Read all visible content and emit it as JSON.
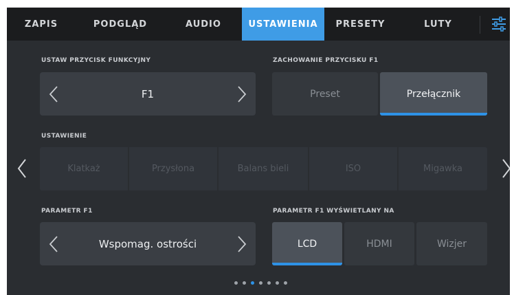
{
  "tabs": [
    {
      "label": "ZAPIS"
    },
    {
      "label": "PODGLĄD"
    },
    {
      "label": "AUDIO"
    },
    {
      "label": "USTAWIENIA",
      "active": true
    },
    {
      "label": "PRESETY"
    },
    {
      "label": "LUTY"
    }
  ],
  "menu_icon": "sliders-icon",
  "function_button": {
    "label": "USTAW PRZYCISK FUNKCYJNY",
    "value": "F1"
  },
  "button_behavior": {
    "label": "ZACHOWANIE PRZYCISKU F1",
    "options": [
      "Preset",
      "Przełącznik"
    ],
    "selected": "Przełącznik"
  },
  "setting": {
    "label": "USTAWIENIE",
    "options": [
      "Klatkaż",
      "Przysłona",
      "Balans bieli",
      "ISO",
      "Migawka"
    ]
  },
  "parameter": {
    "label": "PARAMETR F1",
    "value": "Wspomag. ostrości"
  },
  "displayed_on": {
    "label": "PARAMETR F1 WYŚWIETLANY NA",
    "options": [
      "LCD",
      "HDMI",
      "Wizjer"
    ],
    "selected": "LCD"
  },
  "pagination": {
    "total": 7,
    "current": 3
  },
  "colors": {
    "accent": "#3f9ce6",
    "background": "#2a2d31",
    "tabbar": "#1b1c1e"
  }
}
